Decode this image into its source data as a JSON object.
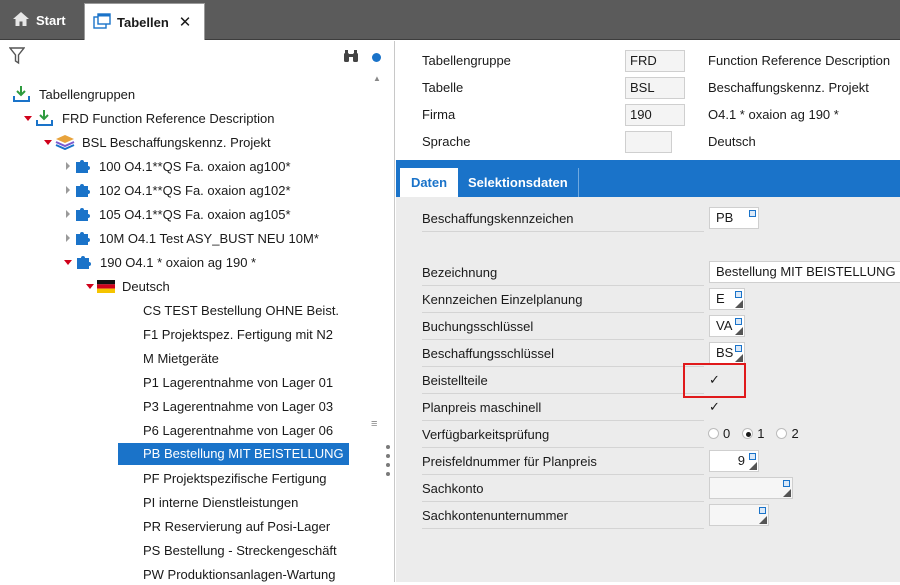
{
  "topbar": {
    "start_label": "Start",
    "tables_tab_label": "Tabellen",
    "close_glyph": "✕"
  },
  "tree": {
    "root": "Tabellengruppen",
    "group": "FRD  Function Reference Description",
    "table": "BSL  Beschaffungskennz. Projekt",
    "companies": [
      {
        "label": "100 O4.1**QS Fa. oxaion ag100*"
      },
      {
        "label": "102 O4.1**QS Fa. oxaion ag102*"
      },
      {
        "label": "105 O4.1**QS Fa. oxaion ag105*"
      },
      {
        "label": "10M O4.1 Test ASY_BUST NEU     10M*"
      },
      {
        "label": "190 O4.1 * oxaion ag 190   *"
      }
    ],
    "language": "Deutsch",
    "entries": [
      {
        "label": "CS  TEST Bestellung OHNE Beist."
      },
      {
        "label": "F1  Projektspez. Fertigung mit N2"
      },
      {
        "label": "M  Mietgeräte"
      },
      {
        "label": "P1  Lagerentnahme von Lager 01"
      },
      {
        "label": "P3  Lagerentnahme von Lager 03"
      },
      {
        "label": "P6  Lagerentnahme von Lager 06"
      },
      {
        "label": "PB  Bestellung MIT BEISTELLUNG"
      },
      {
        "label": "PF  Projektspezifische Fertigung"
      },
      {
        "label": "PI  interne Dienstleistungen"
      },
      {
        "label": "PR  Reservierung auf Posi-Lager"
      },
      {
        "label": "PS  Bestellung - Streckengeschäft"
      },
      {
        "label": "PW  Produktionsanlagen-Wartung"
      }
    ],
    "selected_entry": "PB"
  },
  "header": {
    "rows": [
      {
        "label": "Tabellengruppe",
        "code": "FRD",
        "desc": "Function Reference Description"
      },
      {
        "label": "Tabelle",
        "code": "BSL",
        "desc": "Beschaffungskennz. Projekt"
      },
      {
        "label": "Firma",
        "code": "190",
        "desc": "O4.1 * oxaion ag 190   *"
      },
      {
        "label": "Sprache",
        "code": "",
        "desc": "Deutsch"
      }
    ]
  },
  "tabs": {
    "daten": "Daten",
    "selektion": "Selektionsdaten"
  },
  "form": {
    "beschaffungskennzeichen": {
      "label": "Beschaffungskennzeichen",
      "value": "PB"
    },
    "bezeichnung": {
      "label": "Bezeichnung",
      "value": "Bestellung MIT BEISTELLUNG"
    },
    "kennzeichen_einzelplanung": {
      "label": "Kennzeichen Einzelplanung",
      "value": "E"
    },
    "buchungsschluessel": {
      "label": "Buchungsschlüssel",
      "value": "VA"
    },
    "beschaffungsschluessel": {
      "label": "Beschaffungsschlüssel",
      "value": "BS"
    },
    "beistellteile": {
      "label": "Beistellteile",
      "checked": true,
      "glyph": "✓"
    },
    "planpreis_maschinell": {
      "label": "Planpreis maschinell",
      "checked": true,
      "glyph": "✓"
    },
    "verfuegbarkeitspruefung": {
      "label": "Verfügbarkeitsprüfung",
      "options": [
        "0",
        "1",
        "2"
      ],
      "selected": "1"
    },
    "preisfeldnummer": {
      "label": "Preisfeldnummer für Planpreis",
      "value": "9"
    },
    "sachkonto": {
      "label": "Sachkonto",
      "value": ""
    },
    "sachkontenunternummer": {
      "label": "Sachkontenunternummer",
      "value": ""
    }
  },
  "colors": {
    "accent": "#1a73c9",
    "highlight_border": "#e0191b",
    "topbar": "#5b5b5b"
  }
}
